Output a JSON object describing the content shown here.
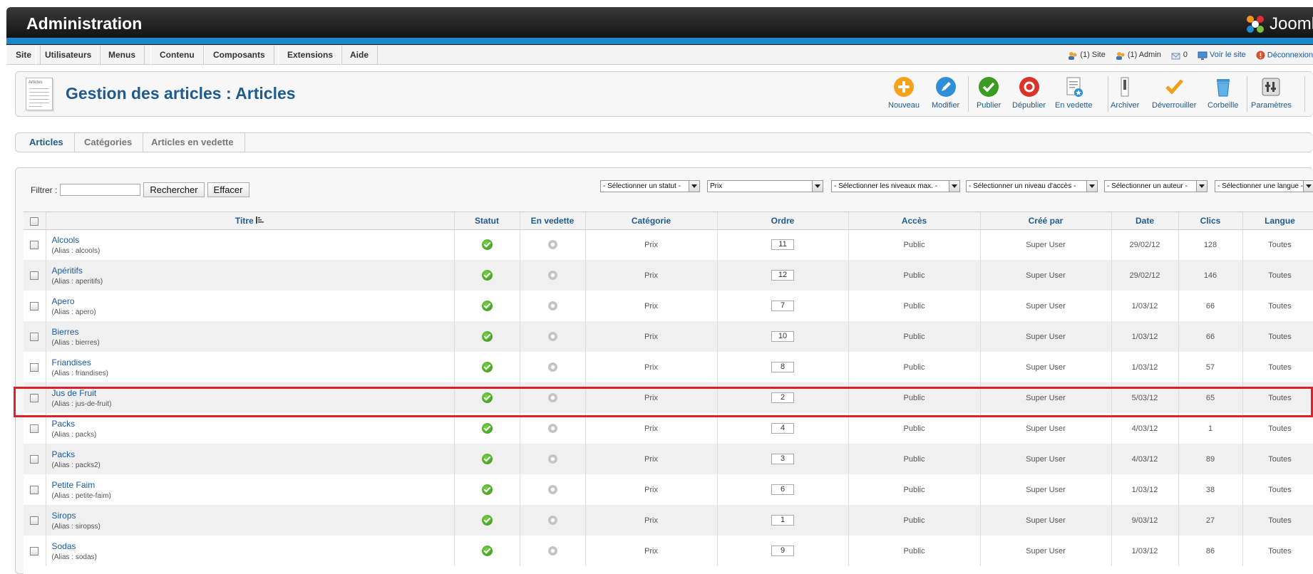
{
  "header": {
    "title": "Administration",
    "logo_text": "Joomla!"
  },
  "menubar": {
    "items": [
      "Site",
      "Utilisateurs",
      "Menus",
      "Contenu",
      "Composants",
      "Extensions",
      "Aide"
    ]
  },
  "status": {
    "site": "(1) Site",
    "admin": "(1) Admin",
    "messages": "0",
    "view_site": "Voir le site",
    "logout": "Déconnexion"
  },
  "toolbar": {
    "page_title": "Gestion des articles : Articles",
    "icon_label": "Articles",
    "buttons": [
      "Nouveau",
      "Modifier",
      "Publier",
      "Dépublier",
      "En vedette",
      "Archiver",
      "Déverrouiller",
      "Corbeille",
      "Paramètres"
    ]
  },
  "subnav": {
    "tabs": [
      "Articles",
      "Catégories",
      "Articles en vedette"
    ],
    "active": "Articles"
  },
  "filter": {
    "label": "Filtrer :",
    "value": "",
    "search_button": "Rechercher",
    "clear_button": "Effacer",
    "selects": [
      "- Sélectionner un statut -",
      "Prix",
      "- Sélectionner les niveaux max. -",
      "- Sélectionner un niveau d'accès -",
      "- Sélectionner un auteur -",
      "- Sélectionner une langue -"
    ]
  },
  "table": {
    "headers": [
      "Titre",
      "Statut",
      "En vedette",
      "Catégorie",
      "Ordre",
      "Accès",
      "Créé par",
      "Date",
      "Clics",
      "Langue"
    ],
    "rows": [
      {
        "title": "Alcools",
        "alias": "(Alias : alcools)",
        "category": "Prix",
        "order": "11",
        "access": "Public",
        "author": "Super User",
        "date": "29/02/12",
        "hits": "128",
        "language": "Toutes"
      },
      {
        "title": "Apéritifs",
        "alias": "(Alias : aperitifs)",
        "category": "Prix",
        "order": "12",
        "access": "Public",
        "author": "Super User",
        "date": "29/02/12",
        "hits": "146",
        "language": "Toutes"
      },
      {
        "title": "Apero",
        "alias": "(Alias : apero)",
        "category": "Prix",
        "order": "7",
        "access": "Public",
        "author": "Super User",
        "date": "1/03/12",
        "hits": "66",
        "language": "Toutes"
      },
      {
        "title": "Bierres",
        "alias": "(Alias : bierres)",
        "category": "Prix",
        "order": "10",
        "access": "Public",
        "author": "Super User",
        "date": "1/03/12",
        "hits": "66",
        "language": "Toutes"
      },
      {
        "title": "Friandises",
        "alias": "(Alias : friandises)",
        "category": "Prix",
        "order": "8",
        "access": "Public",
        "author": "Super User",
        "date": "1/03/12",
        "hits": "57",
        "language": "Toutes"
      },
      {
        "title": "Jus de Fruit",
        "alias": "(Alias : jus-de-fruit)",
        "category": "Prix",
        "order": "2",
        "access": "Public",
        "author": "Super User",
        "date": "5/03/12",
        "hits": "65",
        "language": "Toutes"
      },
      {
        "title": "Packs",
        "alias": "(Alias : packs)",
        "category": "Prix",
        "order": "4",
        "access": "Public",
        "author": "Super User",
        "date": "4/03/12",
        "hits": "1",
        "language": "Toutes"
      },
      {
        "title": "Packs",
        "alias": "(Alias : packs2)",
        "category": "Prix",
        "order": "3",
        "access": "Public",
        "author": "Super User",
        "date": "4/03/12",
        "hits": "89",
        "language": "Toutes"
      },
      {
        "title": "Petite Faim",
        "alias": "(Alias : petite-faim)",
        "category": "Prix",
        "order": "6",
        "access": "Public",
        "author": "Super User",
        "date": "1/03/12",
        "hits": "38",
        "language": "Toutes"
      },
      {
        "title": "Sirops",
        "alias": "(Alias : siropss)",
        "category": "Prix",
        "order": "1",
        "access": "Public",
        "author": "Super User",
        "date": "9/03/12",
        "hits": "27",
        "language": "Toutes"
      },
      {
        "title": "Sodas",
        "alias": "(Alias : sodas)",
        "category": "Prix",
        "order": "9",
        "access": "Public",
        "author": "Super User",
        "date": "1/03/12",
        "hits": "86",
        "language": "Toutes"
      }
    ]
  },
  "colors": {
    "header": "#111111",
    "accent_blue": "#1a87c9",
    "title_blue": "#1f5b8e",
    "link_blue": "#1a5aa6",
    "highlight": "#d9222b",
    "published_green": "#2f8f17"
  }
}
